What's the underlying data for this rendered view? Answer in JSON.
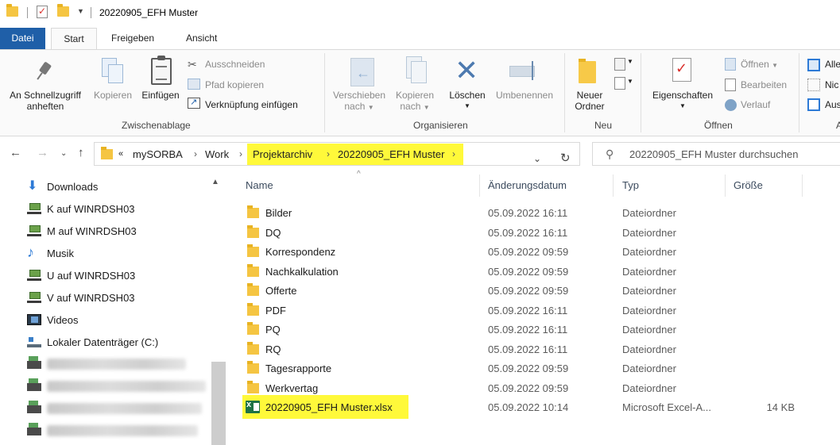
{
  "window": {
    "title": "20220905_EFH Muster"
  },
  "ribbon_tabs": {
    "file": "Datei",
    "start": "Start",
    "share": "Freigeben",
    "view": "Ansicht"
  },
  "ribbon": {
    "clipboard": {
      "pin_line1": "An Schnellzugriff",
      "pin_line2": "anheften",
      "copy": "Kopieren",
      "paste": "Einfügen",
      "cut": "Ausschneiden",
      "copy_path": "Pfad kopieren",
      "paste_shortcut": "Verknüpfung einfügen",
      "group": "Zwischenablage"
    },
    "organize": {
      "move_line1": "Verschieben",
      "move_line2": "nach",
      "copy_line1": "Kopieren",
      "copy_line2": "nach",
      "delete": "Löschen",
      "rename": "Umbenennen",
      "group": "Organisieren"
    },
    "new": {
      "new_folder_line1": "Neuer",
      "new_folder_line2": "Ordner",
      "group": "Neu"
    },
    "open": {
      "properties": "Eigenschaften",
      "open": "Öffnen",
      "edit": "Bearbeiten",
      "history": "Verlauf",
      "group": "Öffnen"
    },
    "select": {
      "all": "Alle",
      "none": "Nic",
      "invert": "Aus",
      "group": "A"
    }
  },
  "address": {
    "overflow": "«",
    "crumbs": [
      "mySORBA",
      "Work",
      "Projektarchiv",
      "20220905_EFH Muster"
    ]
  },
  "search": {
    "placeholder": "20220905_EFH Muster durchsuchen"
  },
  "navpane": {
    "items": [
      {
        "label": "Downloads",
        "icon": "download-icon"
      },
      {
        "label": "K auf WINRDSH03",
        "icon": "network-drive-icon"
      },
      {
        "label": "M auf WINRDSH03",
        "icon": "network-drive-icon"
      },
      {
        "label": "Musik",
        "icon": "music-icon"
      },
      {
        "label": "U auf WINRDSH03",
        "icon": "network-drive-icon"
      },
      {
        "label": "V auf WINRDSH03",
        "icon": "network-drive-icon"
      },
      {
        "label": "Videos",
        "icon": "video-icon"
      },
      {
        "label": "Lokaler Datenträger (C:)",
        "icon": "drive-icon"
      }
    ]
  },
  "columns": {
    "name": "Name",
    "date": "Änderungsdatum",
    "type": "Typ",
    "size": "Größe"
  },
  "files": [
    {
      "name": "Bilder",
      "date": "05.09.2022 16:11",
      "type": "Dateiordner",
      "size": ""
    },
    {
      "name": "DQ",
      "date": "05.09.2022 16:11",
      "type": "Dateiordner",
      "size": ""
    },
    {
      "name": "Korrespondenz",
      "date": "05.09.2022 09:59",
      "type": "Dateiordner",
      "size": ""
    },
    {
      "name": "Nachkalkulation",
      "date": "05.09.2022 09:59",
      "type": "Dateiordner",
      "size": ""
    },
    {
      "name": "Offerte",
      "date": "05.09.2022 09:59",
      "type": "Dateiordner",
      "size": ""
    },
    {
      "name": "PDF",
      "date": "05.09.2022 16:11",
      "type": "Dateiordner",
      "size": ""
    },
    {
      "name": "PQ",
      "date": "05.09.2022 16:11",
      "type": "Dateiordner",
      "size": ""
    },
    {
      "name": "RQ",
      "date": "05.09.2022 16:11",
      "type": "Dateiordner",
      "size": ""
    },
    {
      "name": "Tagesrapporte",
      "date": "05.09.2022 09:59",
      "type": "Dateiordner",
      "size": ""
    },
    {
      "name": "Werkvertag",
      "date": "05.09.2022 09:59",
      "type": "Dateiordner",
      "size": ""
    },
    {
      "name": "20220905_EFH Muster.xlsx",
      "date": "05.09.2022 10:14",
      "type": "Microsoft Excel-A...",
      "size": "14 KB"
    }
  ],
  "colors": {
    "file_tab": "#1f5fa8",
    "highlight": "#fff93a",
    "folder": "#f5c542",
    "excel": "#1f7244"
  }
}
